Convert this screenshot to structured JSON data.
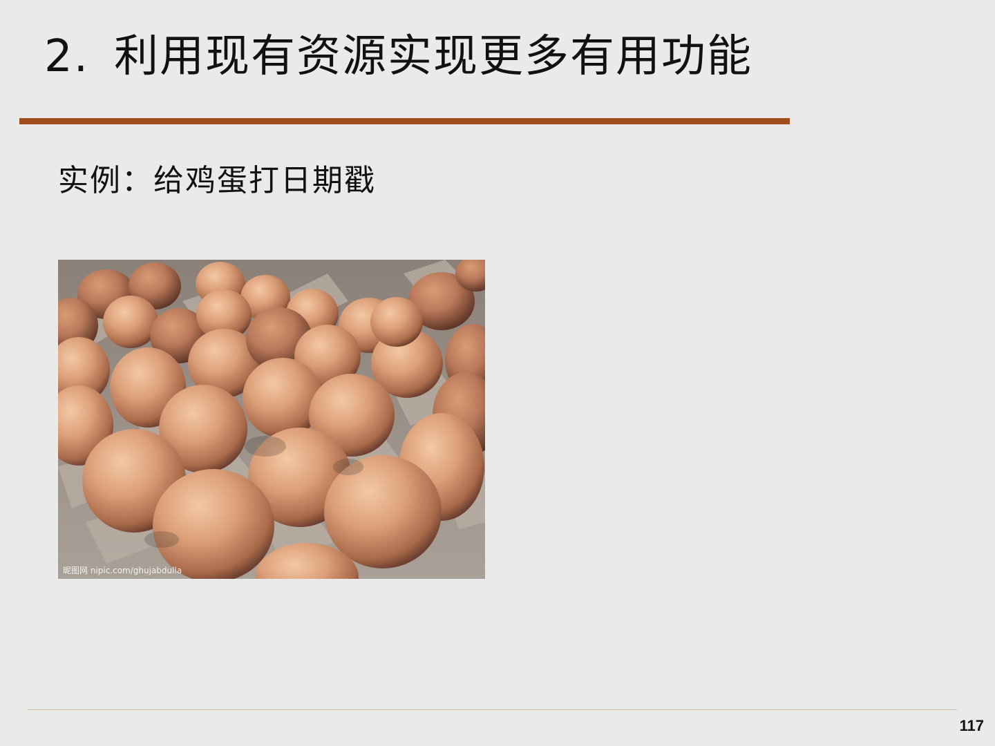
{
  "slide": {
    "title_number": "2.",
    "title_text": "利用现有资源实现更多有用功能",
    "subtitle": "实例：给鸡蛋打日期戳",
    "page_number": "117"
  },
  "photo": {
    "watermark": "昵图网 nipic.com/ghujabdulla"
  },
  "colors": {
    "background": "#eaeaea",
    "title_rule": "#a04d1c",
    "footer_rule": "#c9bfa0"
  }
}
